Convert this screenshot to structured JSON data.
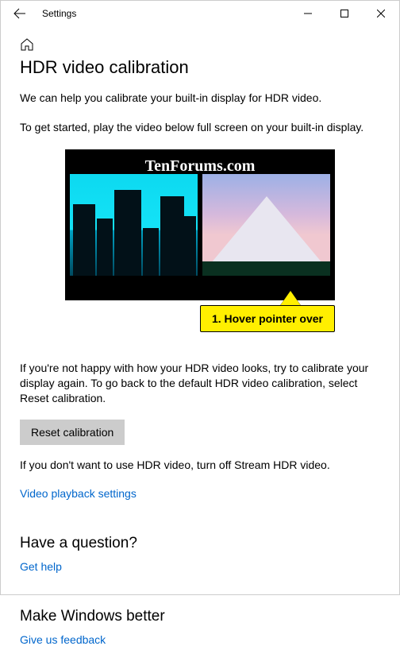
{
  "titlebar": {
    "title": "Settings"
  },
  "page": {
    "heading": "HDR video calibration",
    "intro": "We can help you calibrate your built-in display for HDR video.",
    "getStarted": "To get started, play the video below full screen on your built-in display.",
    "watermark": "TenForums.com",
    "callout": "1. Hover pointer over",
    "notHappy": "If you're not happy with how your HDR video looks, try to calibrate your display again. To go back to the default HDR video calibration, select Reset calibration.",
    "resetButton": "Reset calibration",
    "dontWant": "If you don't want to use HDR video, turn off Stream HDR video.",
    "playbackLink": "Video playback settings",
    "questionHeading": "Have a question?",
    "getHelp": "Get help",
    "feedbackHeading": "Make Windows better",
    "giveFeedback": "Give us feedback"
  }
}
